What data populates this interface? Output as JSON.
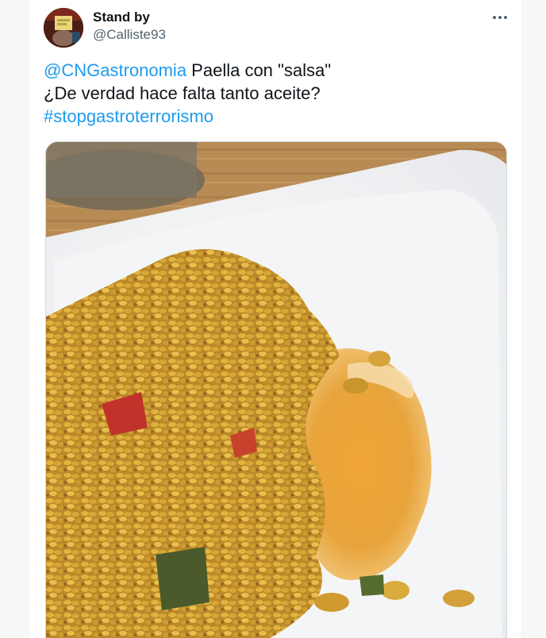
{
  "tweet": {
    "author_name": "Stand by",
    "author_handle": "@Calliste93",
    "more_icon": "more-horizontal-icon",
    "mention": "@CNGastronomia",
    "line1_rest": " Paella con \"salsa\"",
    "line2": "¿De verdad hace falta tanto aceite?",
    "hashtag": "#stopgastroterrorismo",
    "colors": {
      "link": "#1d9bf0",
      "text": "#0f1419",
      "secondary": "#536471"
    }
  }
}
